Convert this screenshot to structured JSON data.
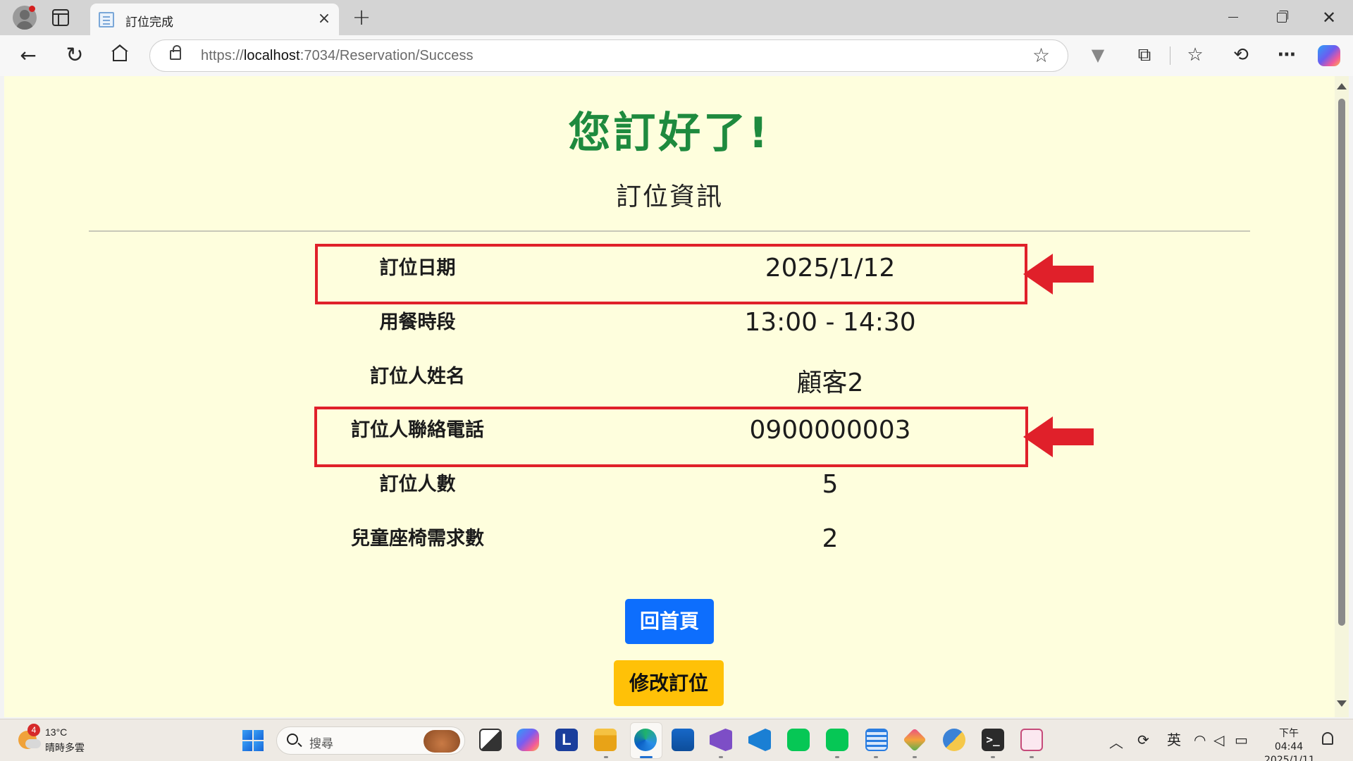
{
  "browser": {
    "tab_title": "訂位完成",
    "url_prefix": "https://",
    "url_host": "localhost",
    "url_rest": ":7034/Reservation/Success",
    "icons": [
      "profile-icon",
      "tab-actions-icon",
      "back-icon",
      "reload-icon",
      "home-icon",
      "lock-icon",
      "star-icon",
      "vivaldi-icon",
      "extensions-icon",
      "favorites-icon",
      "history-icon",
      "more-icon",
      "copilot-icon"
    ]
  },
  "page": {
    "heading": "您訂好了!",
    "section_title": "訂位資訊",
    "rows": [
      {
        "label": "訂位日期",
        "value": "2025/1/12",
        "highlighted": true
      },
      {
        "label": "用餐時段",
        "value": "13:00 - 14:30",
        "highlighted": false
      },
      {
        "label": "訂位人姓名",
        "value": "顧客2",
        "highlighted": false
      },
      {
        "label": "訂位人聯絡電話",
        "value": "0900000003",
        "highlighted": true
      },
      {
        "label": "訂位人數",
        "value": "5",
        "highlighted": false
      },
      {
        "label": "兒童座椅需求數",
        "value": "2",
        "highlighted": false
      }
    ],
    "buttons": {
      "home": "回首頁",
      "edit": "修改訂位"
    },
    "colors": {
      "background": "#fefedd",
      "heading": "#1e8a3e",
      "highlight": "#e0202a",
      "home_button": "#0d6efd",
      "edit_button": "#ffc107"
    }
  },
  "taskbar": {
    "weather_badge": "4",
    "temperature": "13°C",
    "weather_desc": "晴時多雲",
    "search_placeholder": "搜尋",
    "tray_lang": "英",
    "clock_time": "下午 04:44",
    "clock_date": "2025/1/11",
    "apps": [
      "task-view",
      "copilot",
      "l-app",
      "file-explorer",
      "edge",
      "store",
      "visual-studio",
      "vscode",
      "line",
      "line",
      "notepad",
      "git",
      "python",
      "terminal",
      "snipping-tool"
    ]
  }
}
